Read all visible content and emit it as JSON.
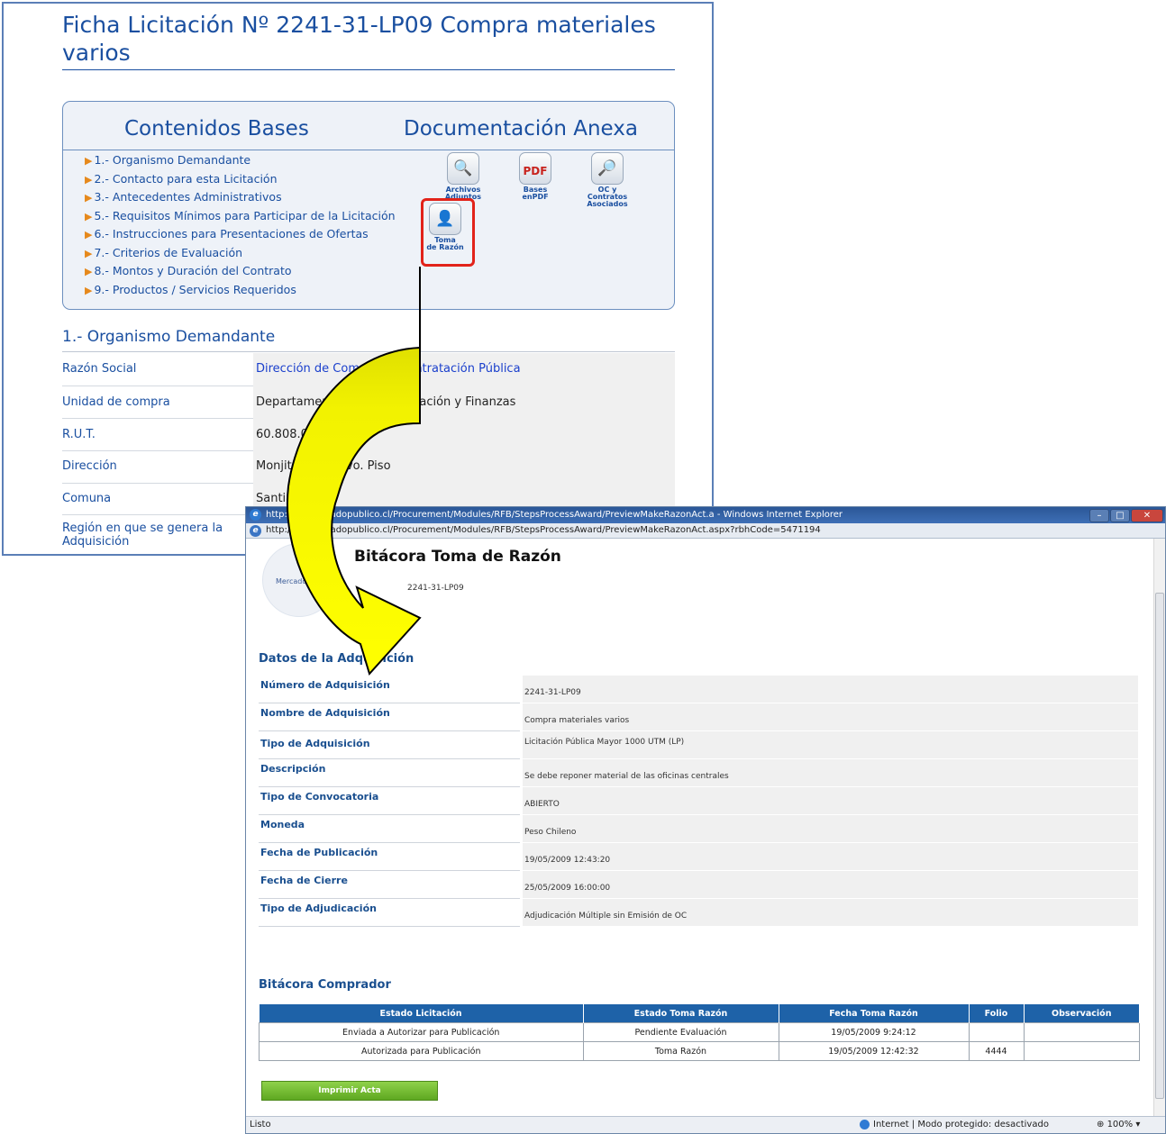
{
  "ficha": {
    "title": "Ficha Licitación Nº 2241-31-LP09 Compra materiales varios",
    "contents_heading": "Contenidos Bases",
    "annex_heading": "Documentación Anexa",
    "links": [
      "1.- Organismo Demandante",
      "2.- Contacto para esta Licitación",
      "3.- Antecedentes Administrativos",
      "5.- Requisitos Mínimos para Participar de la Licitación",
      "6.- Instrucciones para Presentaciones de Ofertas",
      "7.- Criterios de Evaluación",
      "8.- Montos y Duración del Contrato",
      "9.- Productos / Servicios Requeridos"
    ],
    "doc_icons": {
      "archivos_line1": "Archivos",
      "archivos_line2": "Adjuntos",
      "bases_line1": "Bases",
      "bases_line2": "enPDF",
      "oc_line1": "OC y Contratos",
      "oc_line2": "Asociados",
      "toma_line1": "Toma",
      "toma_line2": "de Razón",
      "pdf_badge": "PDF"
    },
    "section_title": "1.- Organismo Demandante",
    "org_rows": [
      {
        "label": "Razón Social",
        "value": "Dirección de Compras y Contratación Pública"
      },
      {
        "label": "Unidad de compra",
        "value": "Departamento de Administración y Finanzas"
      },
      {
        "label": "R.U.T.",
        "value": "60.808.000-7"
      },
      {
        "label": "Dirección",
        "value": "Monjitas 392, 8vo. Piso"
      },
      {
        "label": "Comuna",
        "value": "Santiago"
      },
      {
        "label": "Región en que se genera la Adquisición",
        "value": ""
      }
    ]
  },
  "ie": {
    "title": "http://qa.mercadopublico.cl/Procurement/Modules/RFB/StepsProcessAward/PreviewMakeRazonAct.a - Windows Internet Explorer",
    "address": "http://qa.mercadopublico.cl/Procurement/Modules/RFB/StepsProcessAward/PreviewMakeRazonAct.aspx?rbhCode=5471194",
    "page_title": "Bitácora Toma de Razón",
    "acquisition_number": "2241-31-LP09",
    "logo_text": "Mercado",
    "datos_heading": "Datos de la Adquisición",
    "datos": [
      {
        "label": "Número de Adquisición",
        "value": "2241-31-LP09"
      },
      {
        "label": "Nombre de Adquisición",
        "value": "Compra materiales varios"
      },
      {
        "label": "Tipo de Adquisición",
        "value": "Licitación Pública Mayor 1000 UTM (LP)"
      },
      {
        "label": "Descripción",
        "value": "Se debe reponer material de las oficinas centrales"
      },
      {
        "label": "Tipo de Convocatoria",
        "value": "ABIERTO"
      },
      {
        "label": "Moneda",
        "value": "Peso Chileno"
      },
      {
        "label": "Fecha de Publicación",
        "value": "19/05/2009 12:43:20"
      },
      {
        "label": "Fecha de Cierre",
        "value": "25/05/2009 16:00:00"
      },
      {
        "label": "Tipo de Adjudicación",
        "value": "Adjudicación Múltiple sin Emisión de OC"
      }
    ],
    "bitacora_heading": "Bitácora Comprador",
    "bitacora_columns": [
      "Estado Licitación",
      "Estado Toma Razón",
      "Fecha Toma Razón",
      "Folio",
      "Observación"
    ],
    "bitacora_rows": [
      [
        "Enviada a Autorizar para Publicación",
        "Pendiente Evaluación",
        "19/05/2009 9:24:12",
        "",
        ""
      ],
      [
        "Autorizada para Publicación",
        "Toma Razón",
        "19/05/2009 12:42:32",
        "4444",
        ""
      ]
    ],
    "print_button": "Imprimir Acta",
    "status_left": "Listo",
    "status_zone": "Internet | Modo protegido: desactivado",
    "status_zoom": "100%"
  },
  "colors": {
    "accent_blue": "#1a4fa0",
    "arrow_fill": "#ffff00",
    "arrow_dark": "#c8c800",
    "highlight_red": "#e2231a",
    "table_header": "#1e62a8",
    "button_green": "#6ab82b"
  }
}
